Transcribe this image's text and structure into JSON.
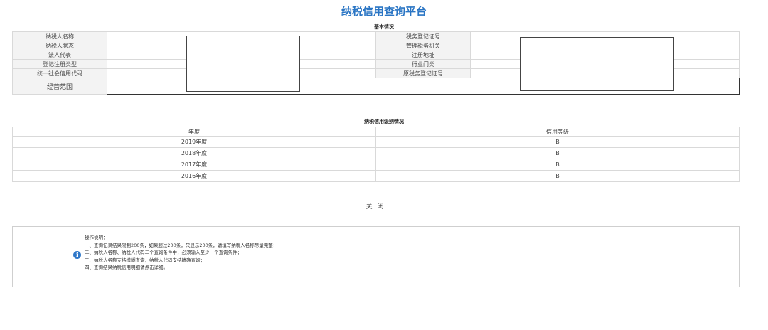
{
  "page": {
    "title": "纳税信用查询平台"
  },
  "basic": {
    "section_title": "基本情况",
    "rows": [
      {
        "left_label": "纳税人名称",
        "right_label": "税务登记证号"
      },
      {
        "left_label": "纳税人状态",
        "right_label": "管理税务机关"
      },
      {
        "left_label": "法人代表",
        "right_label": "注册地址"
      },
      {
        "left_label": "登记注册类型",
        "right_label": "行业门类"
      },
      {
        "left_label": "统一社会信用代码",
        "right_label": "原税务登记证号"
      }
    ],
    "scope_label": "经营范围"
  },
  "credit": {
    "section_title": "纳税信用级别情况",
    "headers": [
      "年度",
      "信用等级"
    ],
    "rows": [
      {
        "year": "2019年度",
        "grade": "B"
      },
      {
        "year": "2018年度",
        "grade": "B"
      },
      {
        "year": "2017年度",
        "grade": "B"
      },
      {
        "year": "2016年度",
        "grade": "B"
      }
    ]
  },
  "actions": {
    "close_label": "关 闭"
  },
  "instructions": {
    "icon": "info-icon",
    "title": "操作说明：",
    "lines": [
      "一、查询记录结果限制200条，如果超过200条，只显示200条，请填写纳税人名称尽量完整；",
      "二、纳税人名称、纳税人代码二个查询条件中，必须输入至少一个查询条件；",
      "三、纳税人名称支持模糊查询，纳税人代码支持精确查询；",
      "四、查询结果纳税信用明细请点击详细。"
    ]
  }
}
